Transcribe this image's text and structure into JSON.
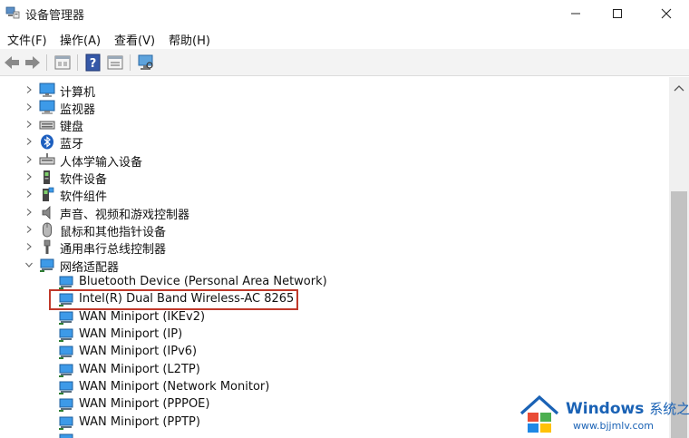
{
  "window": {
    "title": "设备管理器"
  },
  "menu": [
    {
      "label": "文件(F)"
    },
    {
      "label": "操作(A)"
    },
    {
      "label": "查看(V)"
    },
    {
      "label": "帮助(H)"
    }
  ],
  "toolbar": [
    "back-icon",
    "forward-icon",
    "properties-icon",
    "help-icon",
    "update-driver-icon",
    "scan-hardware-icon"
  ],
  "tree": {
    "categories": [
      {
        "label": "计算机",
        "icon": "computer-icon"
      },
      {
        "label": "监视器",
        "icon": "monitor-icon"
      },
      {
        "label": "键盘",
        "icon": "keyboard-icon"
      },
      {
        "label": "蓝牙",
        "icon": "bluetooth-icon"
      },
      {
        "label": "人体学输入设备",
        "icon": "hid-icon"
      },
      {
        "label": "软件设备",
        "icon": "software-device-icon"
      },
      {
        "label": "软件组件",
        "icon": "software-component-icon"
      },
      {
        "label": "声音、视频和游戏控制器",
        "icon": "speaker-icon"
      },
      {
        "label": "鼠标和其他指针设备",
        "icon": "mouse-icon"
      },
      {
        "label": "通用串行总线控制器",
        "icon": "usb-icon"
      }
    ],
    "network": {
      "label": "网络适配器",
      "children": [
        {
          "label": "Bluetooth Device (Personal Area Network)"
        },
        {
          "label": "Intel(R) Dual Band Wireless-AC 8265"
        },
        {
          "label": "WAN Miniport (IKEv2)"
        },
        {
          "label": "WAN Miniport (IP)"
        },
        {
          "label": "WAN Miniport (IPv6)"
        },
        {
          "label": "WAN Miniport (L2TP)"
        },
        {
          "label": "WAN Miniport (Network Monitor)"
        },
        {
          "label": "WAN Miniport (PPPOE)"
        },
        {
          "label": "WAN Miniport (PPTP)"
        }
      ]
    }
  },
  "watermark": {
    "brand": "Windows",
    "brand_cn": "系统之家",
    "url": "www.bjjmlv.com"
  },
  "colors": {
    "highlight": "#c0392b",
    "network_icon": "#2f8fd6",
    "watermark": "#1a62b5"
  }
}
